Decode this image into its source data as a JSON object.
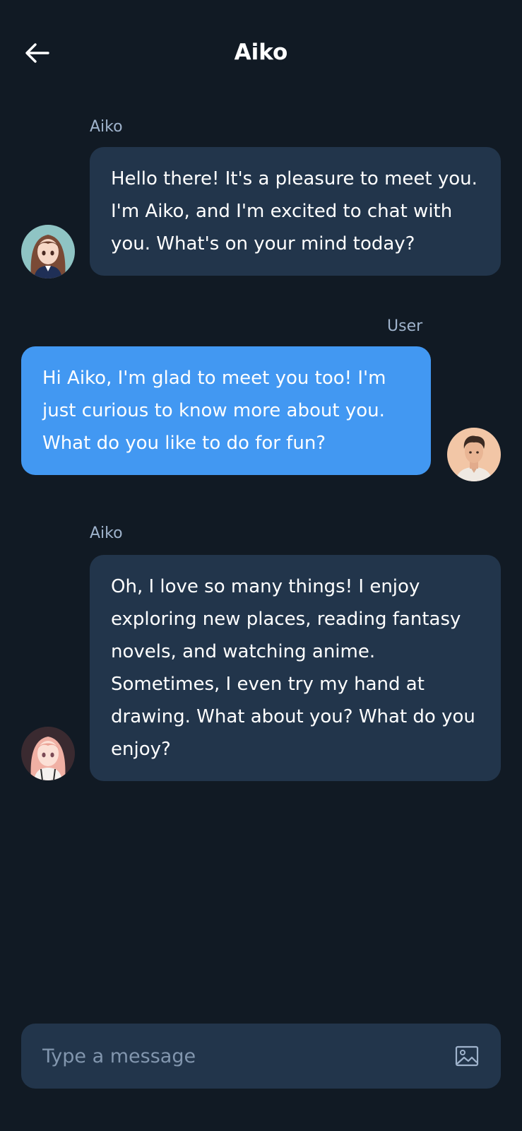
{
  "header": {
    "title": "Aiko",
    "back_icon": "arrow-left-icon"
  },
  "messages": [
    {
      "role": "bot",
      "sender": "Aiko",
      "text": "Hello there! It's a pleasure to meet you. I'm Aiko, and I'm excited to chat with you. What's on your mind today?",
      "avatar": "anime-girl-avatar"
    },
    {
      "role": "user",
      "sender": "User",
      "text": "Hi Aiko, I'm glad to meet you too! I'm just curious to know more about you. What do you like to do for fun?",
      "avatar": "man-avatar"
    },
    {
      "role": "bot",
      "sender": "Aiko",
      "text": "Oh, I love so many things! I enjoy exploring new places, reading fantasy novels, and watching anime. Sometimes, I even try my hand at drawing. What about you? What do you enjoy?",
      "avatar": "anime-girl-pink-hair-avatar"
    }
  ],
  "composer": {
    "placeholder": "Type a message",
    "value": "",
    "attach_icon": "image-icon"
  },
  "colors": {
    "background": "#111a24",
    "bot_bubble": "#22354b",
    "user_bubble": "#4298f2",
    "sender_label": "#9fb3cc"
  }
}
